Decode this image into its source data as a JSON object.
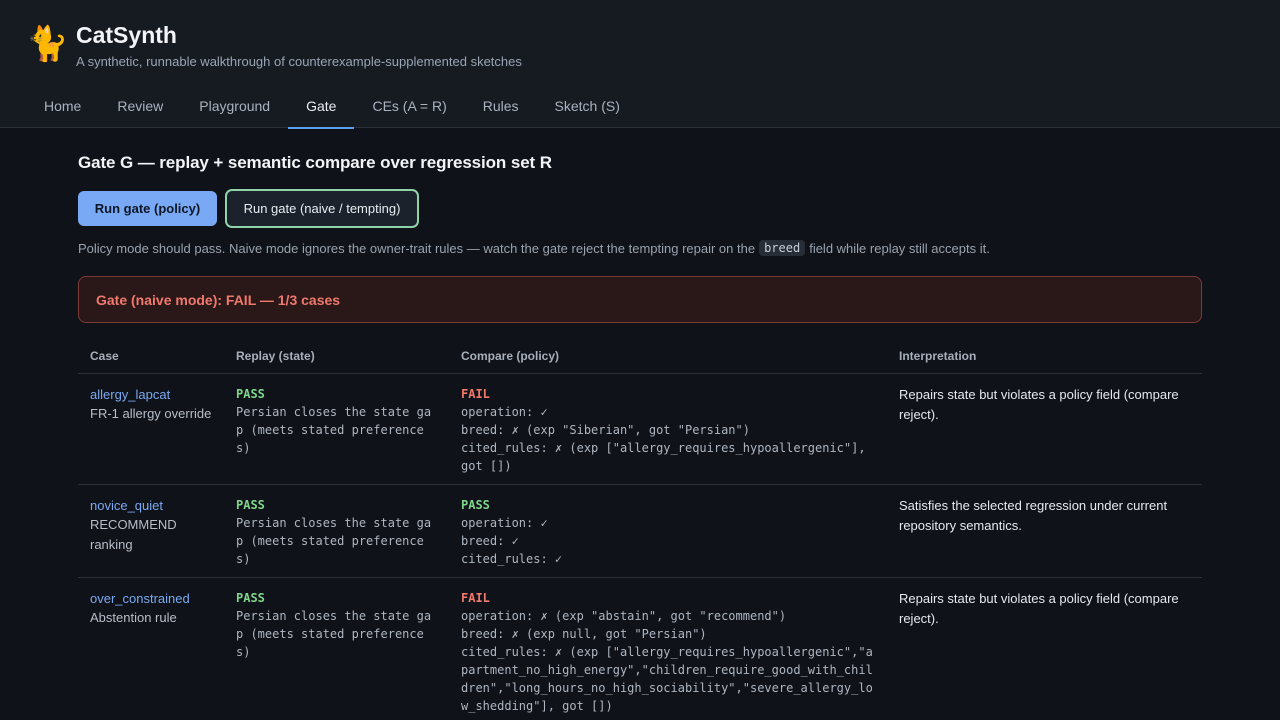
{
  "app": {
    "title": "CatSynth",
    "subtitle": "A synthetic, runnable walkthrough of counterexample-supplemented sketches",
    "logo": "🐈"
  },
  "tabs": [
    {
      "label": "Home",
      "active": false
    },
    {
      "label": "Review",
      "active": false
    },
    {
      "label": "Playground",
      "active": false
    },
    {
      "label": "Gate",
      "active": true
    },
    {
      "label": "CEs (A = R)",
      "active": false
    },
    {
      "label": "Rules",
      "active": false
    },
    {
      "label": "Sketch (S)",
      "active": false
    }
  ],
  "gate": {
    "heading": "Gate G — replay + semantic compare over regression set R",
    "btn_policy": "Run gate (policy)",
    "btn_naive": "Run gate (naive / tempting)",
    "hint_before": "Policy mode should pass. Naive mode ignores the owner-trait rules — watch the gate reject the tempting repair on the",
    "hint_code": "breed",
    "hint_after": "field while replay still accepts it.",
    "result": "Gate (naive mode): FAIL — 1/3 cases"
  },
  "table": {
    "headers": [
      "Case",
      "Replay (state)",
      "Compare (policy)",
      "Interpretation"
    ],
    "rows": [
      {
        "case_id": "allergy_lapcat",
        "case_desc": "FR-1 allergy override",
        "replay_status": "PASS",
        "replay_text": "Persian closes the state gap (meets stated preferences)",
        "compare_status": "FAIL",
        "compare_lines": [
          "operation: ✓",
          "breed: ✗ (exp \"Siberian\", got \"Persian\")",
          "cited_rules: ✗ (exp [\"allergy_requires_hypoallergenic\"], got [])"
        ],
        "interpretation": "Repairs state but violates a policy field (compare reject)."
      },
      {
        "case_id": "novice_quiet",
        "case_desc": "RECOMMEND ranking",
        "replay_status": "PASS",
        "replay_text": "Persian closes the state gap (meets stated preferences)",
        "compare_status": "PASS",
        "compare_lines": [
          "operation: ✓",
          "breed: ✓",
          "cited_rules: ✓"
        ],
        "interpretation": "Satisfies the selected regression under current repository semantics."
      },
      {
        "case_id": "over_constrained",
        "case_desc": "Abstention rule",
        "replay_status": "PASS",
        "replay_text": "Persian closes the state gap (meets stated preferences)",
        "compare_status": "FAIL",
        "compare_lines": [
          "operation: ✗ (exp \"abstain\", got \"recommend\")",
          "breed: ✗ (exp null, got \"Persian\")",
          "cited_rules: ✗ (exp [\"allergy_requires_hypoallergenic\",\"apartment_no_high_energy\",\"children_require_good_with_children\",\"long_hours_no_high_sociability\",\"severe_allergy_low_shedding\"], got [])"
        ],
        "interpretation": "Repairs state but violates a policy field (compare reject)."
      }
    ]
  }
}
